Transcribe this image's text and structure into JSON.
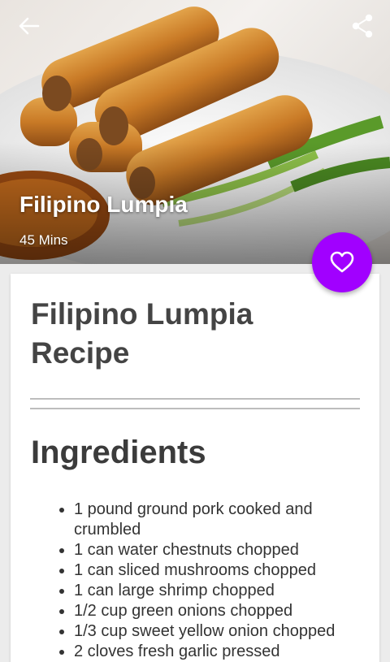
{
  "header": {
    "back_icon": "arrow-left-icon",
    "share_icon": "share-icon",
    "title": "Filipino Lumpia",
    "time": "45 Mins"
  },
  "favorite": {
    "icon": "heart-outline-icon",
    "color": "#a100ff"
  },
  "recipe": {
    "title": "Filipino Lumpia Recipe",
    "ingredients_heading": "Ingredients",
    "ingredients": [
      "1 pound ground pork cooked and crumbled",
      "1 can water chestnuts chopped",
      "1 can sliced mushrooms chopped",
      "1 can large shrimp chopped",
      "1/2 cup green onions chopped",
      "1/3 cup sweet yellow onion chopped",
      "2 cloves fresh garlic pressed"
    ]
  }
}
